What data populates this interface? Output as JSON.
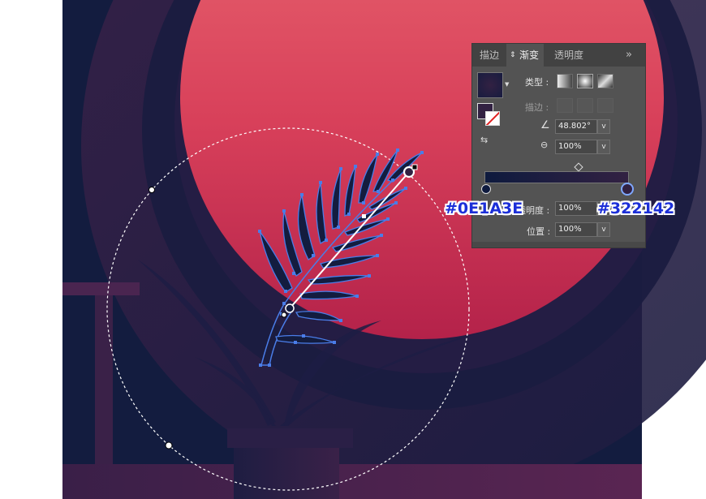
{
  "panel": {
    "tabs": [
      {
        "label": "描边"
      },
      {
        "label": "渐变"
      },
      {
        "label": "透明度"
      }
    ],
    "menu_glyph": "»",
    "type_label": "类型 :",
    "stroke_label": "描边 :",
    "angle_value": "48.802°",
    "aspect_value": "100%",
    "opacity_label": "透明度 :",
    "opacity_value": "100%",
    "position_label": "位置 :",
    "position_value": "100%",
    "dropdown_glyph": "v",
    "gradient_start_color": "#0E1A3E",
    "gradient_end_color": "#322142"
  },
  "annotations": {
    "left_hex": "#0E1A3E",
    "right_hex": "#322142"
  },
  "colors": {
    "background_navy": "#131c3f",
    "sun_top": "#e85c6a",
    "sun_bottom": "#b8244a",
    "floor": "#4a2550",
    "selection": "#4a7de8",
    "annotation_text": "#1c2fd8"
  },
  "icons": {
    "gradient_swatch": "gradient-swatch-icon",
    "angle": "angle-icon",
    "aspect": "aspect-ratio-icon",
    "eyedropper": "eyedropper-icon"
  }
}
